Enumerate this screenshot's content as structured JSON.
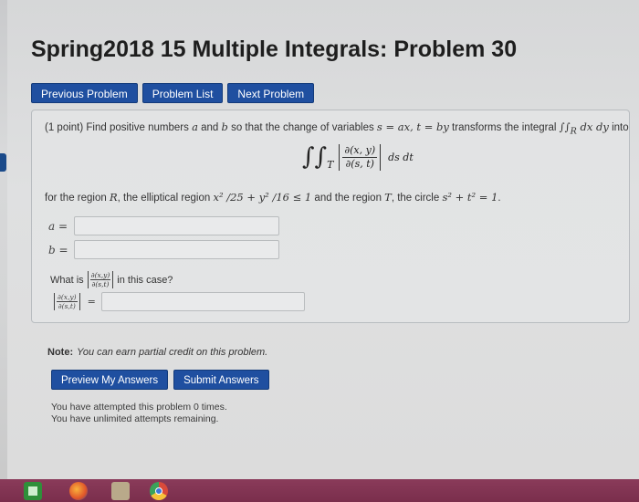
{
  "page": {
    "title": "Spring2018 15 Multiple Integrals: Problem 30"
  },
  "nav": {
    "previous_label": "Previous Problem",
    "list_label": "Problem List",
    "next_label": "Next Problem"
  },
  "problem": {
    "statement_prefix": "(1 point) Find positive numbers ",
    "var_a": "a",
    "and_text": " and ",
    "var_b": "b",
    "statement_mid": " so that the change of variables ",
    "substitution": "s = ax, t = by",
    "statement_suffix": " transforms the integral ",
    "integral_original": "∫∫",
    "region_R_sub": "R",
    "integral_original_diff": " dx dy",
    "into_text": " into",
    "transformed_integral_sign": "∫∫",
    "transformed_sub": "T",
    "jacobian_num": "∂(x, y)",
    "jacobian_den": "∂(s, t)",
    "transformed_diff": "ds dt",
    "region_line_prefix": "for the region ",
    "region_R": "R",
    "region_line_mid": ", the elliptical region ",
    "ellipse": "x² /25 + y² /16 ≤ 1",
    "region_line_mid2": " and the region ",
    "region_T": "T",
    "region_line_mid3": ", the circle ",
    "circle": "s² + t² = 1",
    "region_line_end": "."
  },
  "answers": {
    "a_label": "a =",
    "a_value": "",
    "b_label": "b =",
    "b_value": "",
    "whatis_prefix": "What is",
    "whatis_suffix": "in this case?",
    "jac_num_small": "∂(x,y)",
    "jac_den_small": "∂(s,t)",
    "jac_eq": "=",
    "jac_value": ""
  },
  "note": {
    "label": "Note:",
    "text": "You can earn partial credit on this problem."
  },
  "buttons": {
    "preview_label": "Preview My Answers",
    "submit_label": "Submit Answers"
  },
  "attempts": {
    "line1": "You have attempted this problem 0 times.",
    "line2": "You have unlimited attempts remaining."
  },
  "taskbar": {
    "icons": [
      "store-icon",
      "firefox-icon",
      "app-icon",
      "chrome-icon"
    ]
  }
}
